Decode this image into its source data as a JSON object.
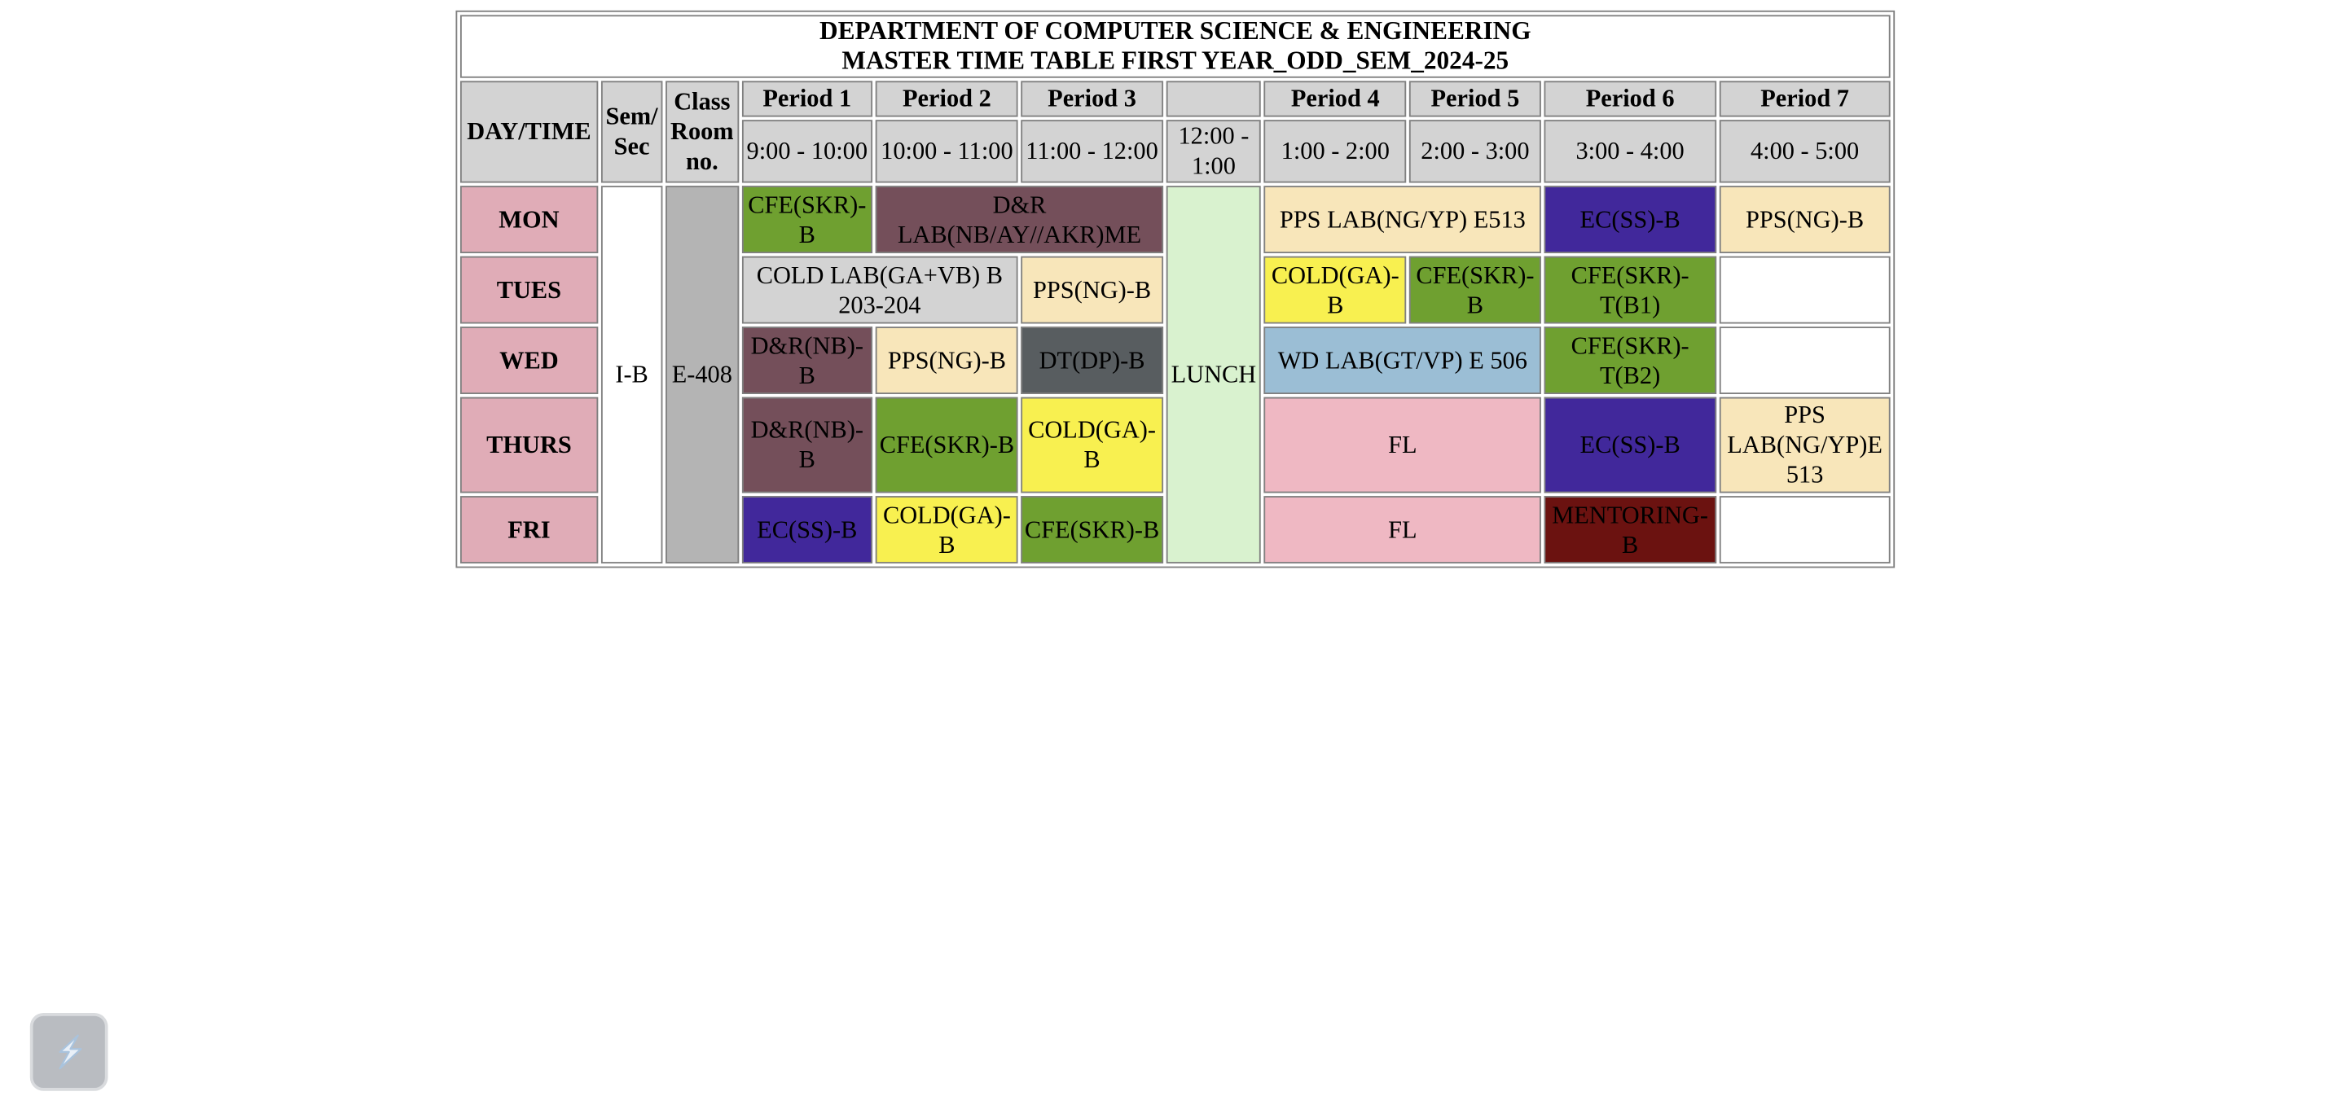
{
  "title": {
    "line1": "DEPARTMENT OF COMPUTER SCIENCE & ENGINEERING",
    "line2": "MASTER TIME TABLE FIRST YEAR_ODD_SEM_2024-25"
  },
  "header": {
    "day_time": "DAY/TIME",
    "sem_sec_1": "Sem/",
    "sem_sec_2": "Sec",
    "class_room_1": "Class",
    "class_room_2": "Room",
    "class_room_3": "no.",
    "periods": [
      "Period 1",
      "Period 2",
      "Period 3",
      "Period 4",
      "Period 5",
      "Period 6",
      "Period 7"
    ],
    "times": [
      "9:00 - 10:00",
      "10:00 - 11:00",
      "11:00 - 12:00",
      "12:00 - 1:00",
      "1:00 - 2:00",
      "2:00 - 3:00",
      "3:00 - 4:00",
      "4:00 - 5:00"
    ]
  },
  "sem_sec": "I-B",
  "room": "E-408",
  "lunch": "LUNCH",
  "days": [
    {
      "day": "MON",
      "cells": [
        {
          "text": "CFE(SKR)-B",
          "color": "#6fa030",
          "fg": "#000000"
        },
        {
          "text": "D&R LAB(NB/AY//AKR)ME",
          "color": "#744f5a",
          "fg": "#000000"
        },
        {
          "text": "PPS LAB(NG/YP) E513",
          "color": "#f8e6ba",
          "fg": "#000000"
        },
        {
          "text": "EC(SS)-B",
          "color": "#41289b",
          "fg": "#000000"
        },
        {
          "text": "PPS(NG)-B",
          "color": "#f8e6ba",
          "fg": "#000000"
        }
      ]
    },
    {
      "day": "TUES",
      "cells": [
        {
          "text": "COLD LAB(GA+VB) B 203-204",
          "color": "#d3d3d3",
          "fg": "#000000"
        },
        {
          "text": "PPS(NG)-B",
          "color": "#f8e6ba",
          "fg": "#000000"
        },
        {
          "text": "COLD(GA)-B",
          "color": "#f8f050",
          "fg": "#000000"
        },
        {
          "text": "CFE(SKR)-B",
          "color": "#6fa030",
          "fg": "#000000"
        },
        {
          "text": "CFE(SKR)-T(B1)",
          "color": "#6fa030",
          "fg": "#000000"
        },
        {
          "text": "",
          "color": "#ffffff",
          "fg": "#000000"
        }
      ]
    },
    {
      "day": "WED",
      "cells": [
        {
          "text": "D&R(NB)-B",
          "color": "#744f5a",
          "fg": "#000000"
        },
        {
          "text": "PPS(NG)-B",
          "color": "#f8e6ba",
          "fg": "#000000"
        },
        {
          "text": "DT(DP)-B",
          "color": "#585d60",
          "fg": "#000000"
        },
        {
          "text": "WD LAB(GT/VP) E 506",
          "color": "#9bbed5",
          "fg": "#000000"
        },
        {
          "text": "CFE(SKR)-T(B2)",
          "color": "#6fa030",
          "fg": "#000000"
        },
        {
          "text": "",
          "color": "#ffffff",
          "fg": "#000000"
        }
      ]
    },
    {
      "day": "THURS",
      "cells": [
        {
          "text": "D&R(NB)-B",
          "color": "#744f5a",
          "fg": "#000000"
        },
        {
          "text": "CFE(SKR)-B",
          "color": "#6fa030",
          "fg": "#000000"
        },
        {
          "text": "COLD(GA)-B",
          "color": "#f8f050",
          "fg": "#000000"
        },
        {
          "text": "FL",
          "color": "#efb8c3",
          "fg": "#000000"
        },
        {
          "text": "EC(SS)-B",
          "color": "#41289b",
          "fg": "#000000"
        },
        {
          "text": "PPS LAB(NG/YP)E 513",
          "color": "#f8e6ba",
          "fg": "#000000"
        }
      ]
    },
    {
      "day": "FRI",
      "cells": [
        {
          "text": "EC(SS)-B",
          "color": "#41289b",
          "fg": "#000000"
        },
        {
          "text": "COLD(GA)-B",
          "color": "#f8f050",
          "fg": "#000000"
        },
        {
          "text": "CFE(SKR)-B",
          "color": "#6fa030",
          "fg": "#000000"
        },
        {
          "text": "FL",
          "color": "#efb8c3",
          "fg": "#000000"
        },
        {
          "text": "MENTORING-B",
          "color": "#6b1210",
          "fg": "#000000"
        },
        {
          "text": "",
          "color": "#ffffff",
          "fg": "#000000"
        }
      ]
    }
  ],
  "assistant_button": {
    "icon": "assistant-logo-icon",
    "bg": "#b9bcc1"
  }
}
